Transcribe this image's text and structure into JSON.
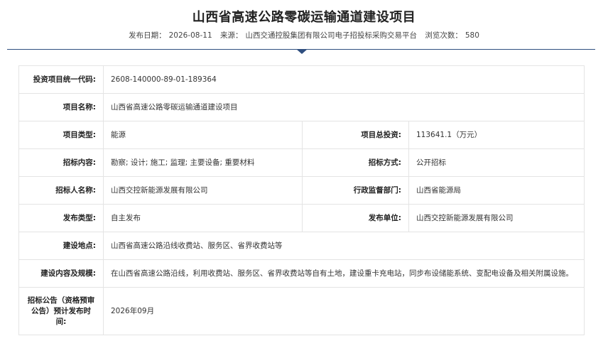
{
  "header": {
    "title": "山西省高速公路零碳运输通道建设项目",
    "publish_date_label": "发布日期：",
    "publish_date": "2026-08-11",
    "source_label": "来源：",
    "source": "山西交通控股集团有限公司电子招投标采购交易平台",
    "views_label": "浏览次数：",
    "views": "580"
  },
  "details": {
    "project_code_label": "投资项目统一代码:",
    "project_code": "2608-140000-89-01-189364",
    "project_name_label": "项目名称:",
    "project_name": "山西省高速公路零碳运输通道建设项目",
    "project_type_label": "项目类型:",
    "project_type": "能源",
    "total_investment_label": "项目总投资:",
    "total_investment": "113641.1（万元）",
    "bid_content_label": "招标内容:",
    "bid_content": "勘察; 设计; 施工; 监理; 主要设备; 重要材料",
    "bid_method_label": "招标方式:",
    "bid_method": "公开招标",
    "tenderer_label": "招标人名称:",
    "tenderer": "山西交控新能源发展有限公司",
    "supervisor_label": "行政监督部门:",
    "supervisor": "山西省能源局",
    "publish_type_label": "发布类型:",
    "publish_type": "自主发布",
    "publisher_label": "发布单位:",
    "publisher": "山西交控新能源发展有限公司",
    "location_label": "建设地点:",
    "location": "山西省高速公路沿线收费站、服务区、省界收费站等",
    "scope_label": "建设内容及规模:",
    "scope": "在山西省高速公路沿线，利用收费站、服务区、省界收费站等自有土地，建设重卡充电站，同步布设储能系统、变配电设备及相关附属设施。",
    "notice_time_label": "招标公告（资格预审公告）预计发布时间:",
    "notice_time": "2026年09月"
  }
}
